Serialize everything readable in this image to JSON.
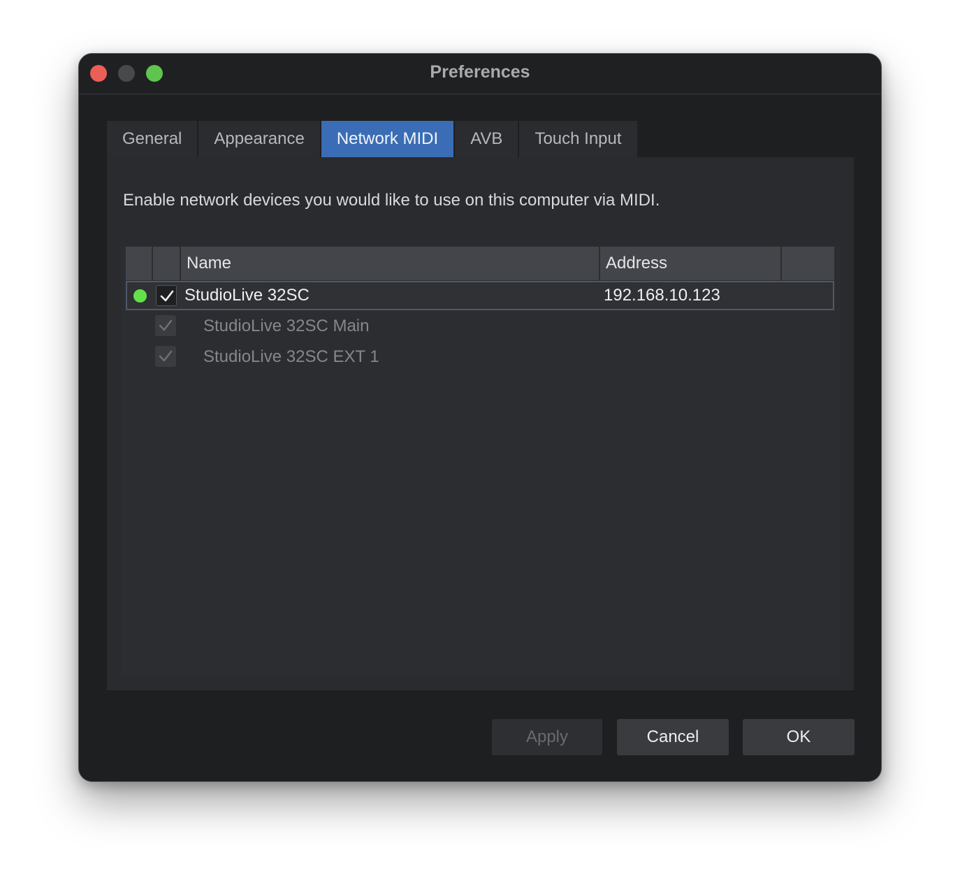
{
  "window": {
    "title": "Preferences"
  },
  "tabs": [
    {
      "label": "General",
      "active": false
    },
    {
      "label": "Appearance",
      "active": false
    },
    {
      "label": "Network MIDI",
      "active": true
    },
    {
      "label": "AVB",
      "active": false
    },
    {
      "label": "Touch Input",
      "active": false
    }
  ],
  "panel": {
    "description": "Enable network devices you would like to use on this computer via MIDI.",
    "table": {
      "headers": {
        "name": "Name",
        "address": "Address"
      },
      "device": {
        "name": "StudioLive 32SC",
        "address": "192.168.10.123",
        "status": "connected",
        "status_color": "#63e14a",
        "checked": true
      },
      "ports": [
        {
          "name": "StudioLive 32SC Main",
          "checked": true,
          "disabled": true
        },
        {
          "name": "StudioLive 32SC EXT 1",
          "checked": true,
          "disabled": true
        }
      ]
    }
  },
  "buttons": {
    "apply": "Apply",
    "cancel": "Cancel",
    "ok": "OK"
  },
  "colors": {
    "accent": "#3a6db5",
    "window_bg": "#1e1f21",
    "panel_bg": "#2a2b2e"
  }
}
